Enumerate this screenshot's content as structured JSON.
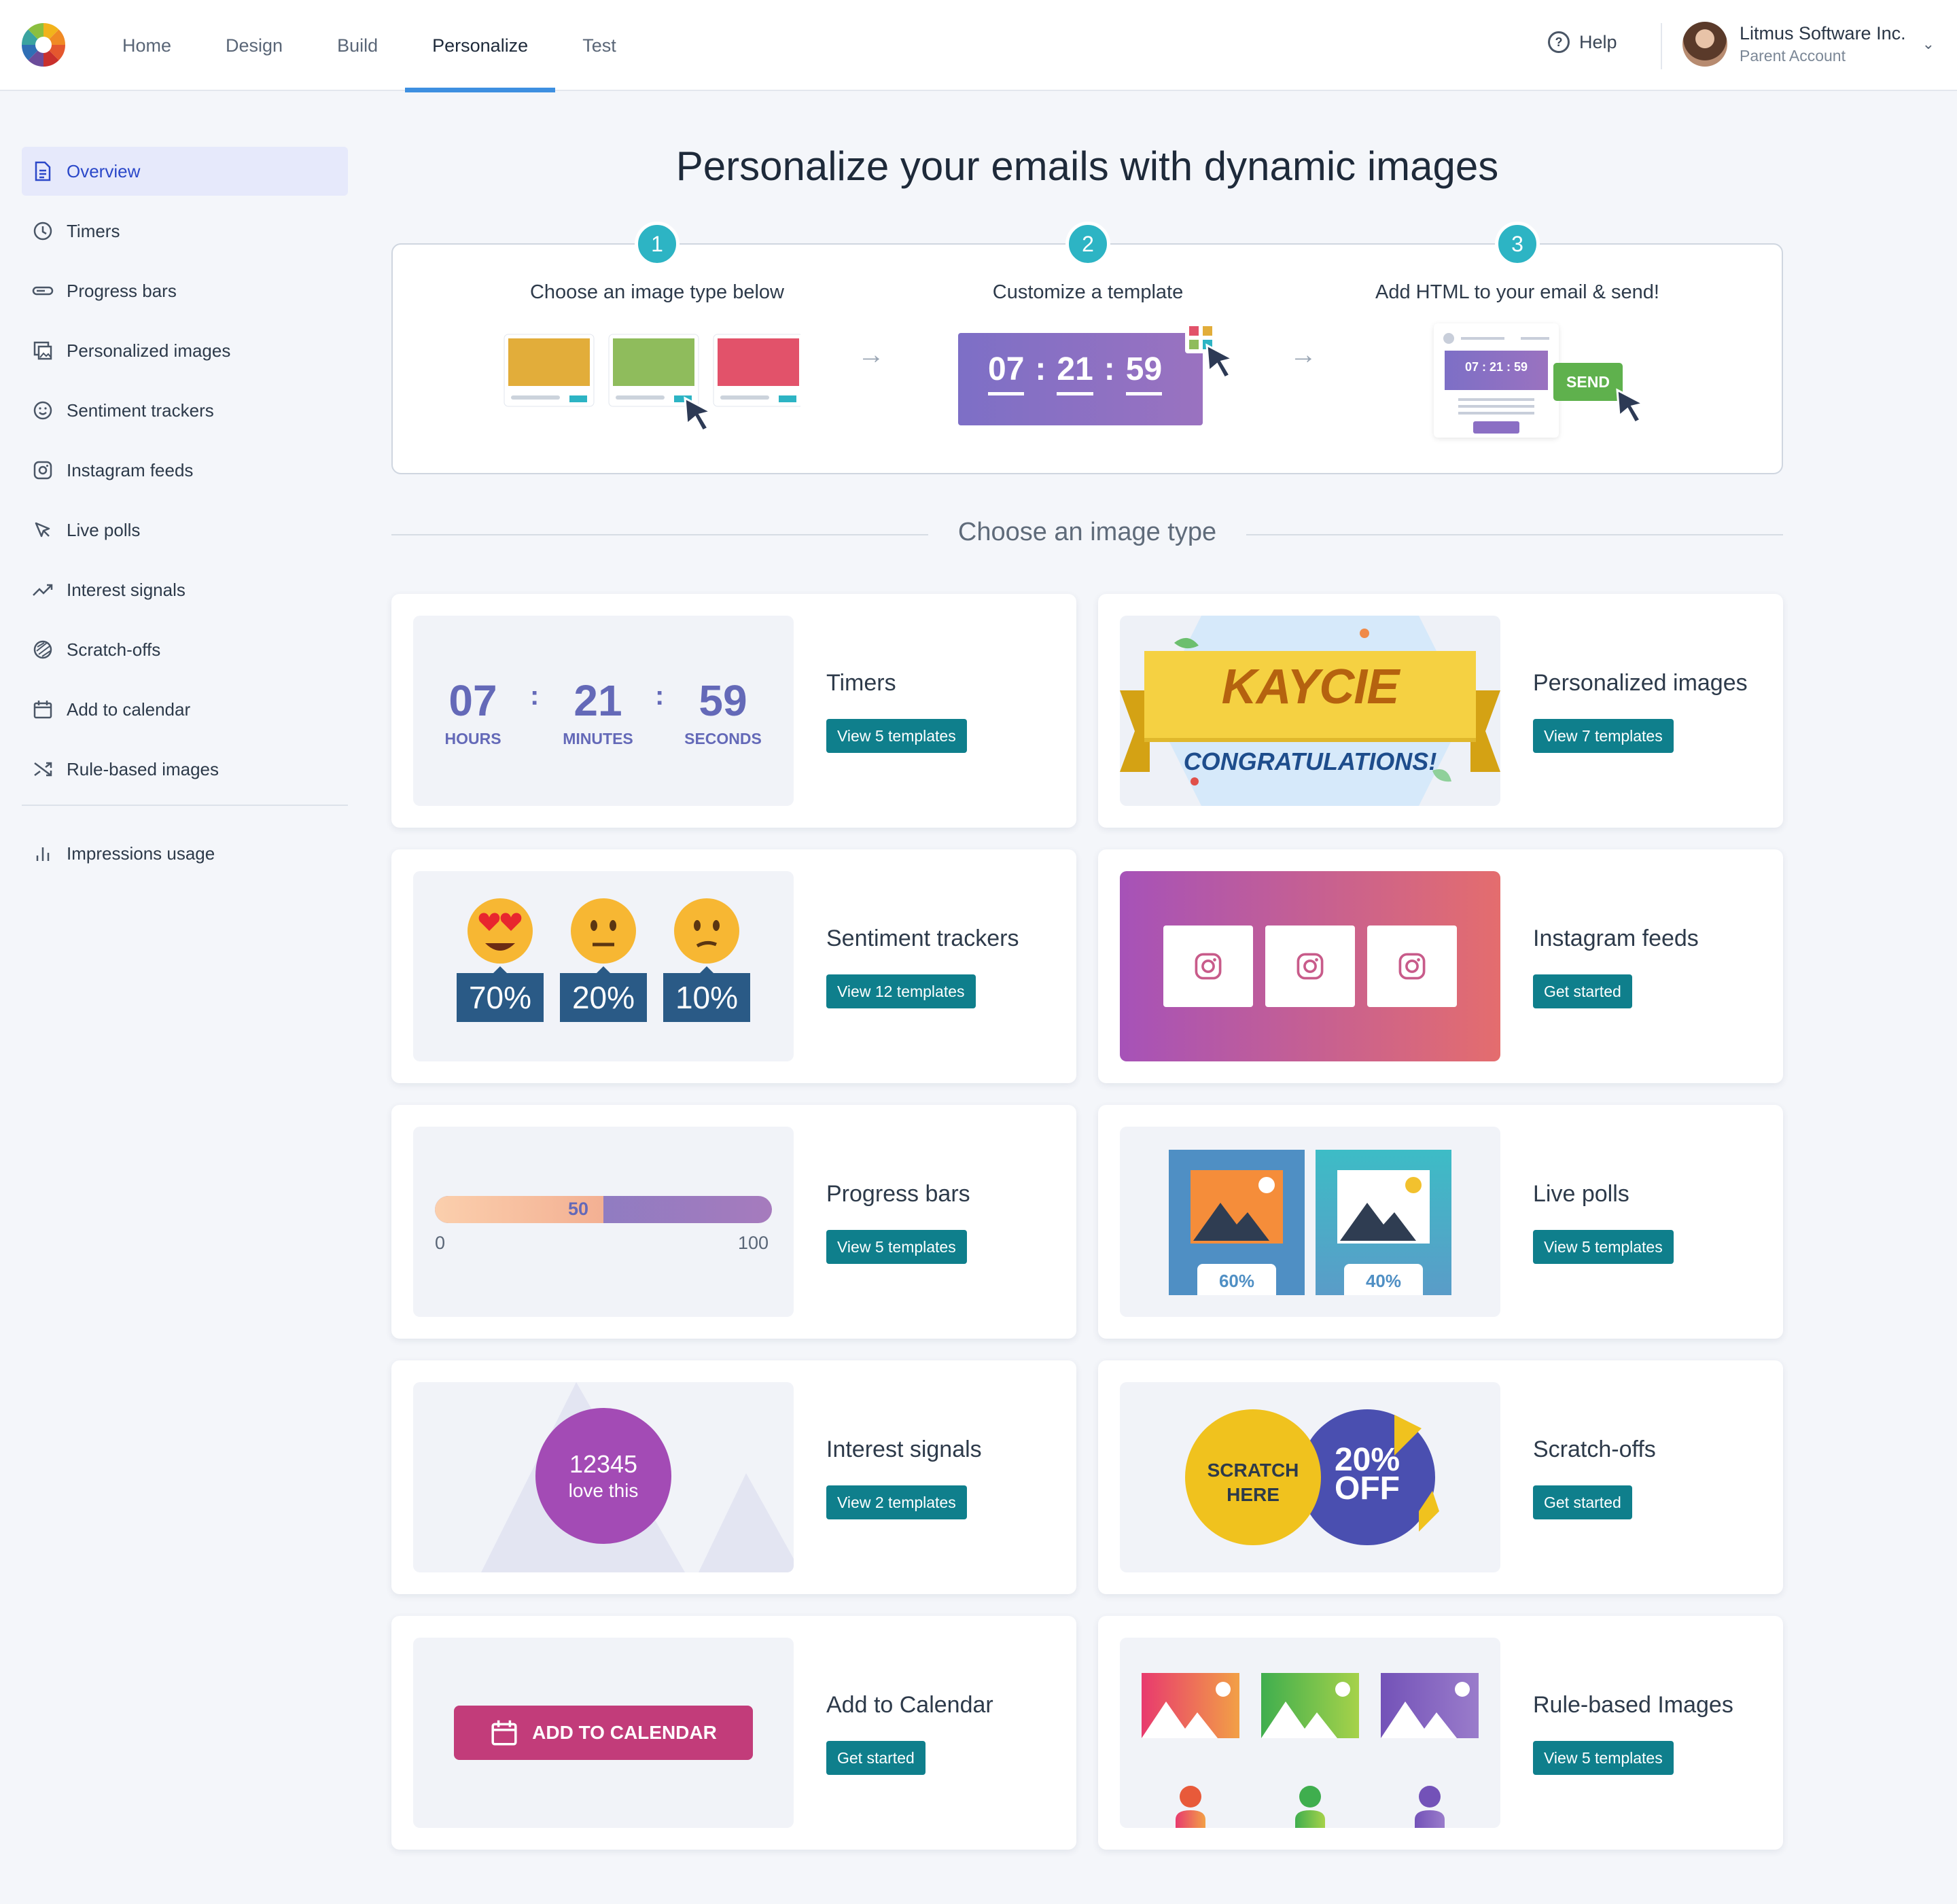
{
  "nav": {
    "items": [
      "Home",
      "Design",
      "Build",
      "Personalize",
      "Test"
    ],
    "active": "Personalize",
    "help": "Help",
    "account_name": "Litmus Software Inc.",
    "account_sub": "Parent Account"
  },
  "sidebar": {
    "items": [
      {
        "label": "Overview",
        "icon": "document-icon"
      },
      {
        "label": "Timers",
        "icon": "clock-icon"
      },
      {
        "label": "Progress bars",
        "icon": "progress-bar-icon"
      },
      {
        "label": "Personalized images",
        "icon": "image-icon"
      },
      {
        "label": "Sentiment trackers",
        "icon": "smiley-icon"
      },
      {
        "label": "Instagram feeds",
        "icon": "instagram-icon"
      },
      {
        "label": "Live polls",
        "icon": "cursor-icon"
      },
      {
        "label": "Interest signals",
        "icon": "trend-icon"
      },
      {
        "label": "Scratch-offs",
        "icon": "scratch-icon"
      },
      {
        "label": "Add to calendar",
        "icon": "calendar-icon"
      },
      {
        "label": "Rule-based images",
        "icon": "shuffle-icon"
      }
    ],
    "footer_item": {
      "label": "Impressions usage",
      "icon": "bar-chart-icon"
    }
  },
  "page": {
    "title": "Personalize your emails with dynamic images",
    "steps": [
      {
        "num": "1",
        "label": "Choose an image type below"
      },
      {
        "num": "2",
        "label": "Customize a template"
      },
      {
        "num": "3",
        "label": "Add HTML to your email & send!"
      }
    ],
    "step2_timer": {
      "h": "07",
      "m": "21",
      "s": "59"
    },
    "step3_timer": "07 : 21 : 59",
    "step3_send": "SEND",
    "section_title": "Choose an image type"
  },
  "cards": {
    "timers": {
      "title": "Timers",
      "button": "View 5 templates",
      "hours": "07",
      "minutes": "21",
      "seconds": "59",
      "hours_label": "HOURS",
      "minutes_label": "MINUTES",
      "seconds_label": "SECONDS"
    },
    "personalized": {
      "title": "Personalized images",
      "button": "View 7 templates",
      "name": "KAYCIE",
      "banner": "CONGRATULATIONS!"
    },
    "sentiment": {
      "title": "Sentiment trackers",
      "button": "View 12 templates",
      "values": [
        "70%",
        "20%",
        "10%"
      ]
    },
    "instagram": {
      "title": "Instagram feeds",
      "button": "Get started"
    },
    "progress": {
      "title": "Progress bars",
      "button": "View 5 templates",
      "value": "50",
      "min": "0",
      "max": "100",
      "fraction": 0.5
    },
    "polls": {
      "title": "Live polls",
      "button": "View 5 templates",
      "a": "60%",
      "b": "40%"
    },
    "interest": {
      "title": "Interest signals",
      "button": "View 2 templates",
      "count": "12345",
      "sub": "love this"
    },
    "scratch": {
      "title": "Scratch-offs",
      "button": "Get started",
      "left": "SCRATCH HERE",
      "right_top": "20%",
      "right_bot": "OFF"
    },
    "calendar": {
      "title": "Add to Calendar",
      "button": "Get started",
      "cta": "ADD TO CALENDAR"
    },
    "rule": {
      "title": "Rule-based Images",
      "button": "View 5 templates"
    }
  },
  "colors": {
    "accent": "#0f7f8c",
    "step": "#2db4c4",
    "nav_underline": "#3d8fe0",
    "sidebar_active": "#e6e9fb"
  }
}
